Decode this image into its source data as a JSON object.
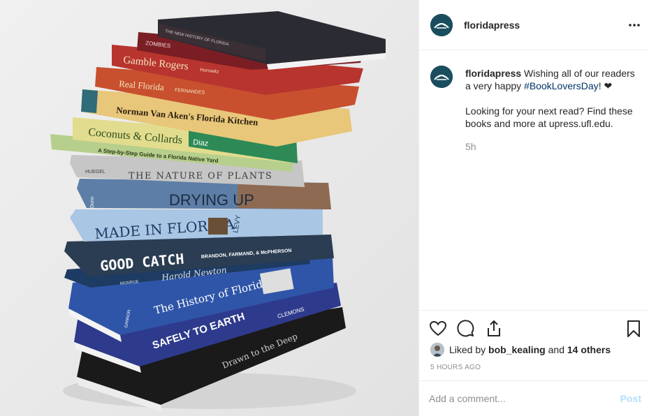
{
  "header": {
    "username": "floridapress",
    "avatar_icon": "floridapress-logo",
    "more_icon": "more-options-icon"
  },
  "caption": {
    "username": "floridapress",
    "text_before_tag": " Wishing all of our readers a very happy ",
    "hashtag": "#BookLoversDay",
    "text_after_tag": "! ❤",
    "second_paragraph": "Looking for your next read? Find these books and more at upress.ufl.edu.",
    "time_ago": "5h"
  },
  "actions": {
    "like_icon": "heart-icon",
    "comment_icon": "comment-icon",
    "share_icon": "share-icon",
    "save_icon": "bookmark-icon"
  },
  "likes": {
    "prefix": "Liked by ",
    "user": "bob_kealing",
    "middle": " and ",
    "others": "14 others"
  },
  "posted": "5 hours ago",
  "comment": {
    "placeholder": "Add a comment...",
    "post_label": "Post"
  },
  "colors": {
    "accent_link": "#003569",
    "post_disabled": "#b2dffc",
    "brand_avatar": "#1a4e5f"
  },
  "books": [
    {
      "title": "THE NEW HISTORY OF FLORIDA"
    },
    {
      "title": "ZOMBIES"
    },
    {
      "title": "Gamble Rogers",
      "author": "Horowitz"
    },
    {
      "title": "Real Florida",
      "author": "FERNANDES"
    },
    {
      "title": "Norman Van Aken's Florida Kitchen"
    },
    {
      "title": "Coconuts & Collards",
      "author": "Diaz"
    },
    {
      "title": "A Step-by-Step Guide to a Florida Native Yard"
    },
    {
      "title": "THE NATURE OF PLANTS",
      "author": "HUEGEL"
    },
    {
      "title": "DRYING UP",
      "author": "Dunn"
    },
    {
      "title": "MADE IN FLORIDA",
      "author": "LEVY"
    },
    {
      "title": "GOOD CATCH",
      "author": "BRANDON, FARMAND, & McPHERSON"
    },
    {
      "title": "Harold Newton",
      "author": "MONROE"
    },
    {
      "title": "The History of Florida",
      "author": "GANNON"
    },
    {
      "title": "SAFELY TO EARTH",
      "author": "CLEMONS"
    },
    {
      "title": "Drawn to the Deep"
    }
  ]
}
